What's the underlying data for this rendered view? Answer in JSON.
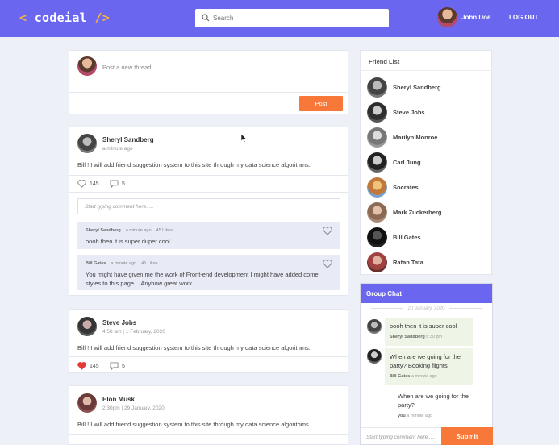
{
  "header": {
    "logo_open": "<",
    "logo_text": "codeial",
    "logo_close": "/>",
    "search_placeholder": "Search",
    "user_name": "John Doe",
    "logout_label": "LOG OUT"
  },
  "composer": {
    "placeholder": "Post a new thread.....",
    "post_label": "Post"
  },
  "posts": [
    {
      "author": "Sheryl Sandberg",
      "time": "a minute ago",
      "text": "Bill ! I will add friend suggestion system to this site through my data science algorithms.",
      "likes": "145",
      "comments": "5",
      "liked": false,
      "comment_placeholder": "Start typing comment here.....",
      "comment_list": [
        {
          "author": "Sheryl Sandberg",
          "time": "a minute ago",
          "likes": "45 Likes",
          "text": "oooh then it is super duper cool"
        },
        {
          "author": "Bill Gates",
          "time": "a minute ago",
          "likes": "45 Likes",
          "text": "You might have given me the work of Front-end development I might have added come styles to this page....Anyhow great work."
        }
      ]
    },
    {
      "author": "Steve Jobs",
      "time": "4:58 am | 1 February, 2020",
      "text": "Bill ! I will add friend suggestion system to this site through my data science algorithms.",
      "likes": "145",
      "comments": "5",
      "liked": true
    },
    {
      "author": "Elon Musk",
      "time": "2:30pm | 29 January, 2020",
      "text": "Bill ! I will add friend suggestion system to this site through my data science algorithms."
    }
  ],
  "friends": {
    "title": "Friend List",
    "items": [
      {
        "name": "Sheryl Sandberg"
      },
      {
        "name": "Steve Jobs"
      },
      {
        "name": "Marilyn Monroe"
      },
      {
        "name": "Carl Jung"
      },
      {
        "name": "Socrates"
      },
      {
        "name": "Mark Zuckerberg"
      },
      {
        "name": "Bill Gates"
      },
      {
        "name": "Ratan Tata"
      }
    ]
  },
  "chat": {
    "title": "Group Chat",
    "date": "20 January, 2020",
    "messages": [
      {
        "text": "oooh then it is super cool",
        "author": "Sheryl Sandberg",
        "time": "6:30 pm"
      },
      {
        "text": "When are we going for the party? Booking flights",
        "author": "Bill Gates",
        "time": "a minute ago"
      },
      {
        "text": "When are we going for the party?",
        "author": "you",
        "time": "a minute ago"
      }
    ],
    "input_placeholder": "Start typing comment here.....",
    "submit_label": "Submit"
  },
  "colors": {
    "primary": "#6a66f0",
    "accent": "#f8783a",
    "background": "#eef0f8",
    "comment_bg": "#e8eaf6",
    "liked_heart": "#e53935"
  },
  "icons": [
    "search-icon",
    "heart-icon",
    "comment-icon",
    "cursor-icon"
  ]
}
